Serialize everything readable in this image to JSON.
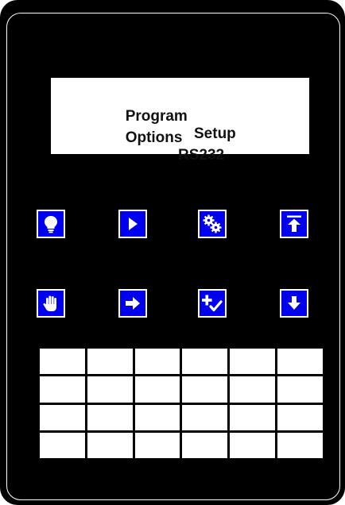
{
  "display": {
    "line1_left": "Program",
    "line1_right": "Setup",
    "line2_left": "Options",
    "line2_right": "RS232"
  },
  "keys": [
    {
      "name": "lightbulb-key",
      "icon": "lightbulb-icon"
    },
    {
      "name": "play-key",
      "icon": "play-icon"
    },
    {
      "name": "gears-key",
      "icon": "gears-icon"
    },
    {
      "name": "arrow-up-to-top-key",
      "icon": "arrow-up-to-top-icon"
    },
    {
      "name": "hand-key",
      "icon": "hand-icon"
    },
    {
      "name": "arrow-right-key",
      "icon": "arrow-right-icon"
    },
    {
      "name": "plus-check-key",
      "icon": "plus-check-icon"
    },
    {
      "name": "arrow-down-key",
      "icon": "arrow-down-icon"
    }
  ],
  "keypad": {
    "rows": 4,
    "columns": 6
  },
  "colors": {
    "key_fill": "#0000ee",
    "background": "#000000",
    "display_fill": "#ffffff"
  }
}
